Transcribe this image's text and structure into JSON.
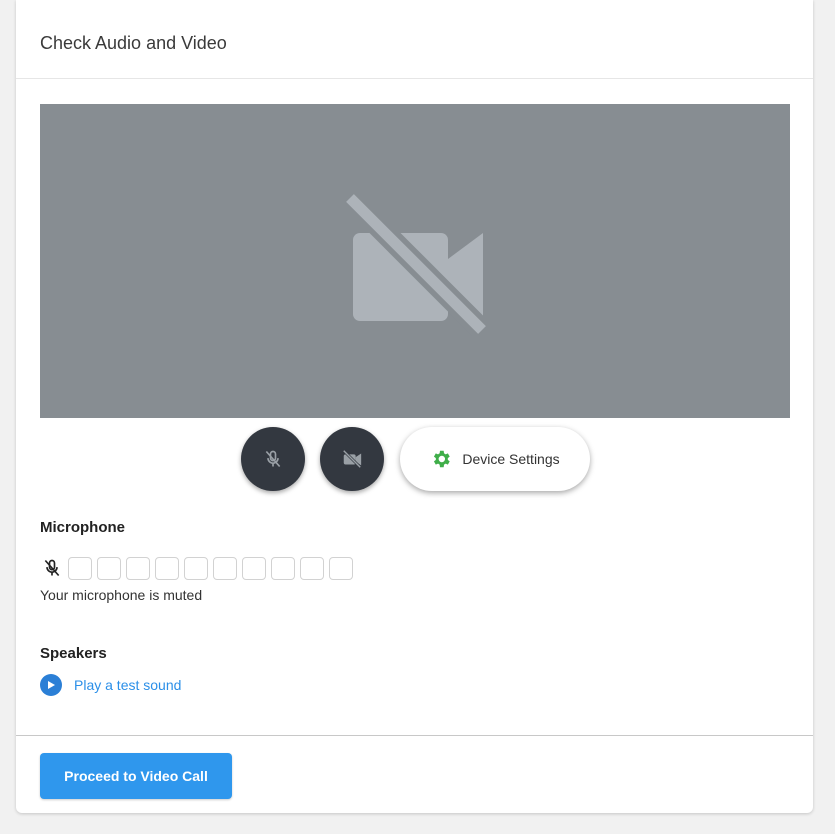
{
  "header": {
    "title": "Check Audio and Video"
  },
  "preview": {
    "icon": "video-off-icon",
    "background": "#878d92",
    "icon_color": "#adb3b9"
  },
  "controls": {
    "mic_toggle_icon": "mic-off-icon",
    "camera_toggle_icon": "video-off-icon",
    "device_settings_label": "Device Settings",
    "device_settings_icon": "gear-icon",
    "gear_color": "#3fae49"
  },
  "microphone": {
    "title": "Microphone",
    "status": "Your microphone is muted",
    "level_segments": 10,
    "level": 0
  },
  "speakers": {
    "title": "Speakers",
    "test_sound_label": "Play a test sound",
    "link_color": "#2b8fe8"
  },
  "footer": {
    "proceed_label": "Proceed to Video Call",
    "button_color": "#2f97ed"
  }
}
